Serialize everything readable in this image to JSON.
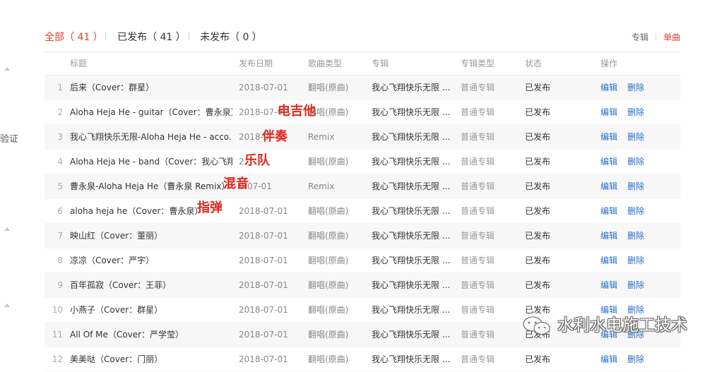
{
  "left_strip": {
    "partial_text": "验证"
  },
  "filter": {
    "tabs": [
      {
        "label": "全部",
        "count": "（ 41 ）"
      },
      {
        "label": "已发布",
        "count": "（ 41 ）"
      },
      {
        "label": "未发布",
        "count": "（ 0 ）"
      }
    ],
    "view_album": "专辑",
    "view_single": "单曲"
  },
  "table": {
    "headers": {
      "title": "标题",
      "date": "发布日期",
      "genre": "歌曲类型",
      "album": "专辑",
      "album_type": "专辑类型",
      "status": "状态",
      "actions": "操作"
    },
    "edit_label": "编辑",
    "delete_label": "删除",
    "rows": [
      {
        "no": "1",
        "title": "后来（Cover：群星）",
        "date": "2018-07-01",
        "genre": "翻唱(原曲)",
        "album": "我心飞翔快乐无限 ...",
        "album_type": "普通专辑",
        "status": "已发布"
      },
      {
        "no": "2",
        "title": "Aloha Heja He - guitar（Cover：曹永泉）",
        "date": "2018-07-0",
        "genre": "翻唱(原曲)",
        "album": "我心飞翔快乐无限 ...",
        "album_type": "普通专辑",
        "status": "已发布"
      },
      {
        "no": "3",
        "title": "我心飞翔快乐无限-Aloha Heja He - acco...",
        "date": "2018-0",
        "genre": "Remix",
        "album": "我心飞翔快乐无限 ...",
        "album_type": "普通专辑",
        "status": "已发布"
      },
      {
        "no": "4",
        "title": "Aloha Heja He - band（Cover：我心飞翔...",
        "date": "2",
        "genre": "翻唱(原曲)",
        "album": "我心飞翔快乐无限 ...",
        "album_type": "普通专辑",
        "status": "已发布"
      },
      {
        "no": "5",
        "title": "曹永泉-Aloha Heja He（曹永泉 Remix）",
        "date": "8-07-01",
        "genre": "Remix",
        "album": "我心飞翔快乐无限 ...",
        "album_type": "普通专辑",
        "status": "已发布"
      },
      {
        "no": "6",
        "title": "aloha heja he（Cover：曹永泉）",
        "date": "2018-07-01",
        "genre": "翻唱(原曲)",
        "album": "我心飞翔快乐无限 ...",
        "album_type": "普通专辑",
        "status": "已发布"
      },
      {
        "no": "7",
        "title": "映山红（Cover：董丽）",
        "date": "2018-07-01",
        "genre": "翻唱(原曲)",
        "album": "我心飞翔快乐无限 ...",
        "album_type": "普通专辑",
        "status": "已发布"
      },
      {
        "no": "8",
        "title": "凉凉（Cover：严宇）",
        "date": "2018-07-01",
        "genre": "翻唱(原曲)",
        "album": "我心飞翔快乐无限 ...",
        "album_type": "普通专辑",
        "status": "已发布"
      },
      {
        "no": "9",
        "title": "百年孤寂（Cover：王菲）",
        "date": "2018-07-01",
        "genre": "翻唱(原曲)",
        "album": "我心飞翔快乐无限 ...",
        "album_type": "普通专辑",
        "status": "已发布"
      },
      {
        "no": "10",
        "title": "小燕子（Cover：群星）",
        "date": "2018-07-01",
        "genre": "翻唱(原曲)",
        "album": "我心飞翔快乐无限 ...",
        "album_type": "普通专辑",
        "status": "已发布"
      },
      {
        "no": "11",
        "title": "All Of Me（Cover：严学莹）",
        "date": "2018-07-01",
        "genre": "翻唱(原曲)",
        "album": "我心飞翔快乐无限 ...",
        "album_type": "普通专辑",
        "status": "已发布"
      },
      {
        "no": "12",
        "title": "美美哒（Cover：门丽）",
        "date": "2018-07-01",
        "genre": "翻唱(原曲)",
        "album": "我心飞翔快乐无限 ...",
        "album_type": "普通专辑",
        "status": "已发布"
      }
    ]
  },
  "annotations": [
    "电吉他",
    "伴奏",
    "乐队",
    "混音",
    "指弹"
  ],
  "watermark": {
    "text": "水利水电施工技术",
    "icon": "wechat-icon"
  },
  "colors": {
    "accent": "#e0412f",
    "link": "#2a6fc7",
    "annotation": "#e0281c"
  }
}
